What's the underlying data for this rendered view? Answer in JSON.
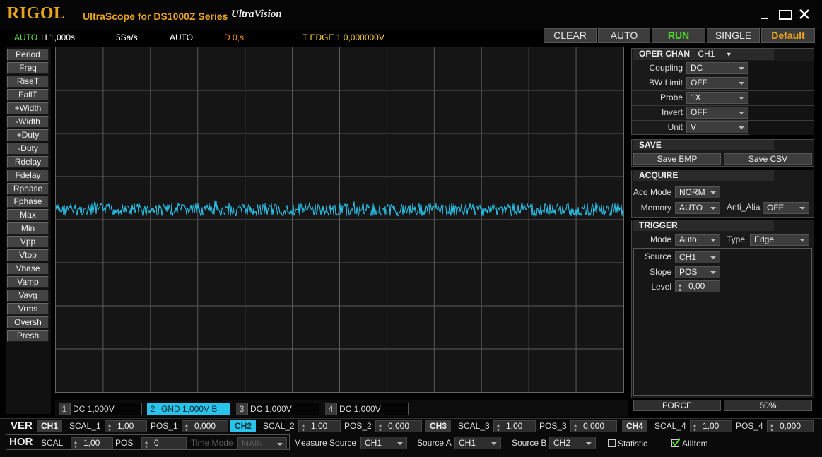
{
  "app": {
    "brand": "RIGOL",
    "title": "UltraScope for DS1000Z Series",
    "logo": "UltraVision",
    "window_controls": [
      "minimize-icon",
      "maximize-icon",
      "close-icon"
    ]
  },
  "status": {
    "mode": "AUTO",
    "hscale": "H 1,000s",
    "srate": "5Sa/s",
    "trig_mode": "AUTO",
    "delay": "D 0,s",
    "trigger": "T EDGE 1 0,000000V"
  },
  "run_buttons": {
    "clear": "CLEAR",
    "auto": "AUTO",
    "run": "RUN",
    "single": "SINGLE",
    "default": "Default"
  },
  "measure_items": [
    "Period",
    "Freq",
    "RiseT",
    "FallT",
    "+Width",
    "-Width",
    "+Duty",
    "-Duty",
    "Rdelay",
    "Fdelay",
    "Rphase",
    "Fphase",
    "Max",
    "Min",
    "Vpp",
    "Vtop",
    "Vbase",
    "Vamp",
    "Vavg",
    "Vrms",
    "Oversh",
    "Presh"
  ],
  "channels": [
    {
      "num": "1",
      "label": "DC 1,000V"
    },
    {
      "num": "2",
      "label": "GND 1,000V B"
    },
    {
      "num": "3",
      "label": "DC 1,000V"
    },
    {
      "num": "4",
      "label": "DC 1,000V"
    }
  ],
  "oper_chan": {
    "header": "OPER CHAN",
    "channel": "CH1",
    "rows": [
      {
        "label": "Coupling",
        "value": "DC"
      },
      {
        "label": "BW Limit",
        "value": "OFF"
      },
      {
        "label": "Probe",
        "value": "1X"
      },
      {
        "label": "Invert",
        "value": "OFF"
      },
      {
        "label": "Unit",
        "value": "V"
      }
    ]
  },
  "save": {
    "header": "SAVE",
    "bmp": "Save BMP",
    "csv": "Save CSV"
  },
  "acquire": {
    "header": "ACQUIRE",
    "acq_mode_label": "Acq Mode",
    "acq_mode": "NORM",
    "memory_label": "Memory",
    "memory": "AUTO",
    "anti_alias_label": "Anti_Alia",
    "anti_alias": "OFF"
  },
  "trigger": {
    "header": "TRIGGER",
    "mode_label": "Mode",
    "mode": "Auto",
    "type_label": "Type",
    "type": "Edge",
    "source_label": "Source",
    "source": "CH1",
    "slope_label": "Slope",
    "slope": "POS",
    "level_label": "Level",
    "level": "0,00",
    "force": "FORCE",
    "percent": "50%"
  },
  "ver": {
    "label": "VER",
    "ch": [
      {
        "tag": "CH1",
        "scal_label": "SCAL_1",
        "scal": "1,00",
        "pos_label": "POS_1",
        "pos": "0,000"
      },
      {
        "tag": "CH2",
        "scal_label": "SCAL_2",
        "scal": "1,00",
        "pos_label": "POS_2",
        "pos": "0,000"
      },
      {
        "tag": "CH3",
        "scal_label": "SCAL_3",
        "scal": "1,00",
        "pos_label": "POS_3",
        "pos": "0,000"
      },
      {
        "tag": "CH4",
        "scal_label": "SCAL_4",
        "scal": "1,00",
        "pos_label": "POS_4",
        "pos": "0,000"
      }
    ]
  },
  "hor": {
    "label": "HOR",
    "scal_label": "SCAL",
    "scal": "1,00",
    "pos_label": "POS",
    "pos": "0",
    "time_mode_label": "Time Mode",
    "time_mode": "MAIN",
    "measure_source_label": "Measure Source",
    "measure_source": "CH1",
    "source_a_label": "Source A",
    "source_a": "CH1",
    "source_b_label": "Source B",
    "source_b": "CH2",
    "statistic_label": "Statistic",
    "allitem_label": "AllItem"
  },
  "colors": {
    "accent": "#e8a31c",
    "trace": "#29c4ec",
    "run": "#4cd62c",
    "status_green": "#5ee04a",
    "delay_orange": "#ff8c1a",
    "trigger_yellow": "#ffd23c"
  }
}
